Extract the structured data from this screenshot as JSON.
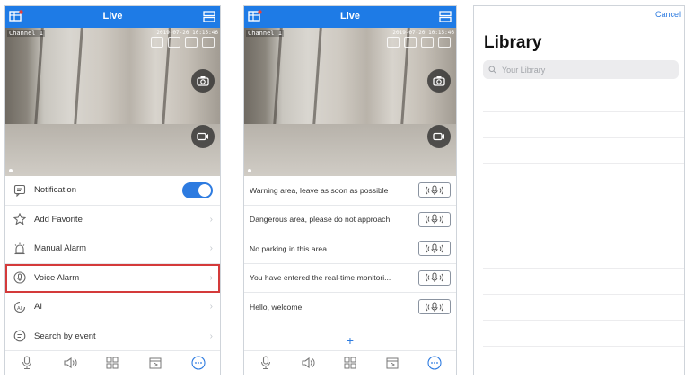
{
  "screen1": {
    "title": "Live",
    "channel": "Channel 1",
    "timestamp": "2019-07-20 10:15:46",
    "menu": [
      {
        "icon": "notification-icon",
        "label": "Notification",
        "control": "toggle",
        "toggle_on": true
      },
      {
        "icon": "star-icon",
        "label": "Add Favorite",
        "control": "chevron"
      },
      {
        "icon": "alarm-icon",
        "label": "Manual Alarm",
        "control": "chevron"
      },
      {
        "icon": "voice-alarm-icon",
        "label": "Voice Alarm",
        "control": "chevron",
        "highlighted": true
      },
      {
        "icon": "ai-icon",
        "label": "AI",
        "control": "chevron"
      },
      {
        "icon": "search-event-icon",
        "label": "Search by event",
        "control": "chevron"
      }
    ]
  },
  "screen2": {
    "title": "Live",
    "channel": "Channel 1",
    "timestamp": "2019-07-20 10:15:46",
    "alarms": [
      "Warning area, leave as soon as possible",
      "Dangerous area, please do not approach",
      "No parking in this area",
      "You have entered the real-time monitori...",
      "Hello, welcome"
    ],
    "add_label": "+"
  },
  "screen3": {
    "cancel_label": "Cancel",
    "title": "Library",
    "search_placeholder": "Your Library"
  },
  "colors": {
    "accent": "#1e7be6",
    "highlight_border": "#d43a3a"
  }
}
